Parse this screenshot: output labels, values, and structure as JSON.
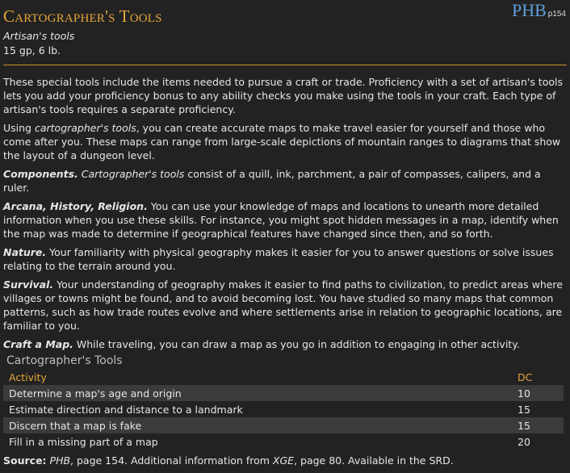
{
  "header": {
    "title": "Cartographer's Tools",
    "source_book": "PHB",
    "source_page": "p154",
    "subtitle": "Artisan's tools",
    "cost_weight": "15 gp, 6 lb."
  },
  "description": {
    "p1": "These special tools include the items needed to pursue a craft or trade. Proficiency with a set of artisan's tools lets you add your proficiency bonus to any ability checks you make using the tools in your craft. Each type of artisan's tools requires a separate proficiency.",
    "p2_pre": "Using ",
    "p2_italic": "cartographer's tools",
    "p2_post": ", you can create accurate maps to make travel easier for yourself and those who come after you. These maps can range from large-scale depictions of mountain ranges to diagrams that show the layout of a dungeon level."
  },
  "sections": {
    "components": {
      "heading": "Components.",
      "italic": "Cartographer's tools",
      "text": " consist of a quill, ink, parchment, a pair of compasses, calipers, and a ruler."
    },
    "arcana": {
      "heading": "Arcana, History, Religion.",
      "text": " You can use your knowledge of maps and locations to unearth more detailed information when you use these skills. For instance, you might spot hidden messages in a map, identify when the map was made to determine if geographical features have changed since then, and so forth."
    },
    "nature": {
      "heading": "Nature.",
      "text": " Your familiarity with physical geography makes it easier for you to answer questions or solve issues relating to the terrain around you."
    },
    "survival": {
      "heading": "Survival.",
      "text": " Your understanding of geography makes it easier to find paths to civilization, to predict areas where villages or towns might be found, and to avoid becoming lost. You have studied so many maps that common patterns, such as how trade routes evolve and where settlements arise in relation to geographic locations, are familiar to you."
    },
    "craft": {
      "heading": "Craft a Map.",
      "text": " While traveling, you can draw a map as you go in addition to engaging in other activity."
    }
  },
  "table": {
    "caption": "Cartographer's Tools",
    "col_activity": "Activity",
    "col_dc": "DC",
    "rows": [
      {
        "activity": "Determine a map's age and origin",
        "dc": "10"
      },
      {
        "activity": "Estimate direction and distance to a landmark",
        "dc": "15"
      },
      {
        "activity": "Discern that a map is fake",
        "dc": "15"
      },
      {
        "activity": "Fill in a missing part of a map",
        "dc": "20"
      }
    ]
  },
  "footer": {
    "label": "Source:",
    "book1": "PHB",
    "mid": ", page 154. Additional information from ",
    "book2": "XGE",
    "end": ", page 80. Available in the SRD."
  },
  "colors": {
    "title": "#e4a63a",
    "source_book": "#5d9edb",
    "rule": "#c88e2a",
    "background": "#222222"
  }
}
